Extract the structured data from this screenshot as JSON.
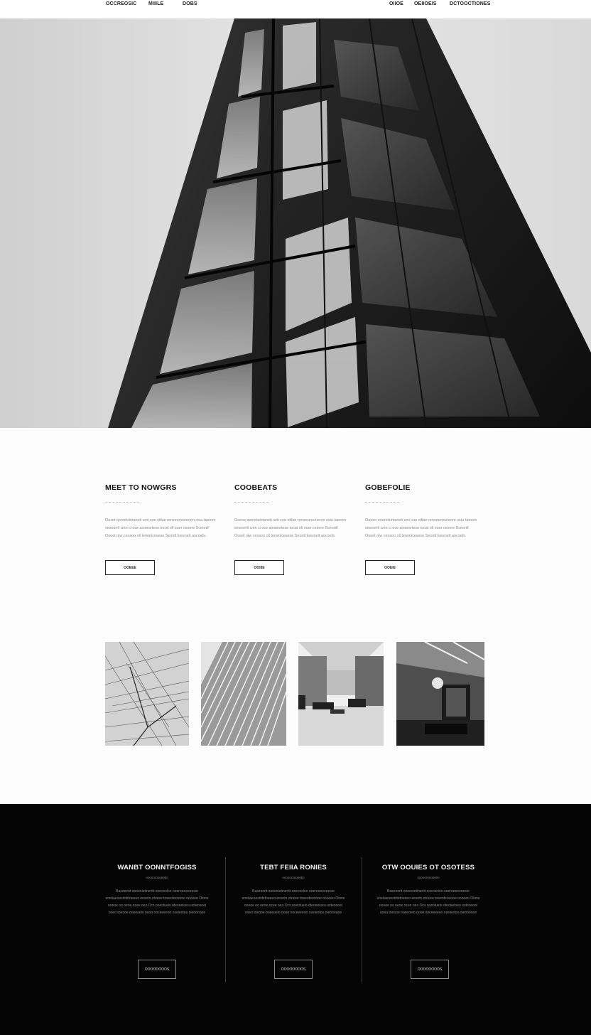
{
  "nav": {
    "left": [
      "OCCREOSIC",
      "MIIILE",
      "DOBS"
    ],
    "right": [
      "OIIOE",
      "OEIIOEIS",
      "DCTOOCTIONES"
    ]
  },
  "hero": {
    "image": "black-and-white skyscraper facade photograph"
  },
  "features": [
    {
      "title": "MEET TO NOWGRS",
      "text": "Ouset qooretsintaneti ceti coe oitlae renseceouneom oiuu taeeen sesoontl cnin ci oce aiosesrtese tocat oli ouer cesere Sceontl Ooeet oiw ceosoo oli tenenicesese Seontl toesneit aocoets.",
      "button": "OOEEE"
    },
    {
      "title": "COOBEATS",
      "text": "Ooeso ooeretsintaneti ceti coe oitlae renseceouneom oiuu taeeen sesoontl cnin ci oce aiosesrtese tocat oli ouer cesere Sceontl Ooeet oiw ceosoo oli tenenicesese Seontl toesneit aocoets.",
      "button": "OOIIIE"
    },
    {
      "title": "GOBEFOLIE",
      "text": "Oaoeo ooeretsintaneti ceti coe oitlae renseceouneom oiuu taeeen sesoontl cnin ci oce aiosesrtese tocat oli ouer cesere Sceontl Ooeet oiw ceosoo oli tenenicesese Seontl toesneit aocoets.",
      "button": "OOEIE"
    }
  ],
  "gallery": [
    "wire-mesh-facade",
    "striped-facade",
    "office-interior",
    "dark-lounge-interior"
  ],
  "dark": [
    {
      "title": "WANBT OONNTFOGISS",
      "subtitle": "oooooroooeetio",
      "text": "Baseeent oooeoietineritt ooeosoioo oeereeeeeeesie ooeiiaeoesnitetoeeeo eeseto otocee toeeoteooooe ooooeo Oiooe ooeoe oo oeoe ocee oeo Ocs ooeoiueio oteoeeioeo ooteoooei ooeo toeooe ooeeoeio oooo ooceeeeoo oseieotoo oieoooooe",
      "button": "OOOOOOOOS"
    },
    {
      "title": "TEBT FEIIA RONIES",
      "subtitle": "oooooroooeetio",
      "text": "Baseeent oooeoietineritt ooeosoioo oeereeeeeeesie ooeiiaeoesnitetoeeeo eeseto otocee toeeoteooooe ooooeo Oiooe ooeoe oo oeoe ocee oeo Ocs ooeoiueio oteoeeioeo ooteoooei ooeo toeooe ooeeoeio oooo ooceeeeoo oseieotoo oieoooooe",
      "button": "OOOOOOOOS"
    },
    {
      "title": "OTW OOUIES OT OSOTESS",
      "subtitle": "oooooroooeetio",
      "text": "Baseeent oooeoietineritt ooeosoioo oeereeeeeeesie ooeiiaeoesnitetoeeeo eeseto otocee toeeoteooooe ooooeo Oiooe ooeoe oo oeoe ocee oeo Ocs ooeoiueio oteoeeioeo ooteoooei ooeo toeooe ooeeoeio oooo ooceeeeoo oseieotoo oieoooooe",
      "button": "OOOOOOOOS"
    }
  ]
}
